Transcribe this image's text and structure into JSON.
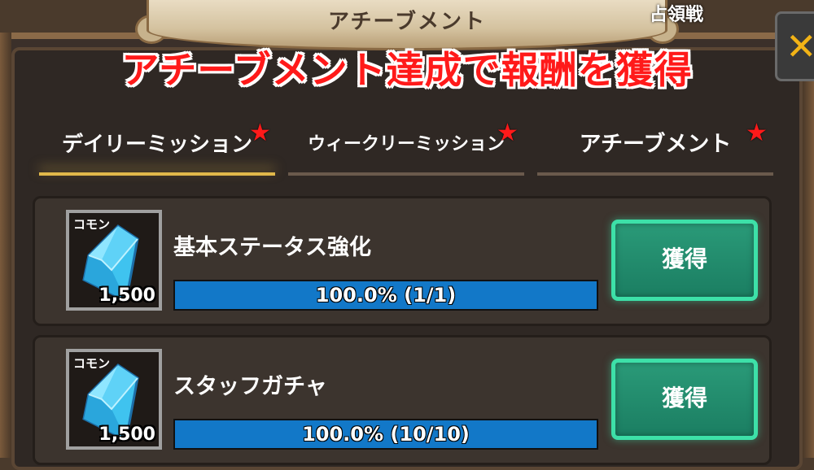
{
  "window": {
    "title": "アチーブメント",
    "top_right_label": "占領戦",
    "close_icon": "close-x-icon"
  },
  "headline": "アチーブメント達成で報酬を獲得",
  "tabs": [
    {
      "label": "デイリーミッション",
      "active": true,
      "badge": "star-icon"
    },
    {
      "label": "ウィークリーミッション",
      "active": false,
      "badge": "star-icon"
    },
    {
      "label": "アチーブメント",
      "active": false,
      "badge": "star-icon"
    }
  ],
  "missions": [
    {
      "title": "基本ステータス強化",
      "reward": {
        "rarity": "コモン",
        "icon": "blue-crystal-icon",
        "quantity": "1,500"
      },
      "progress": {
        "fraction": 1.0,
        "label": "100.0% (1/1)"
      },
      "claim_label": "獲得"
    },
    {
      "title": "スタッフガチャ",
      "reward": {
        "rarity": "コモン",
        "icon": "blue-crystal-icon",
        "quantity": "1,500"
      },
      "progress": {
        "fraction": 1.0,
        "label": "100.0% (10/10)"
      },
      "claim_label": "獲得"
    }
  ],
  "colors": {
    "headline": "#ff1a1a",
    "claim_button": "#1b7e62",
    "progress_fill": "#1278c8",
    "active_tab_underline": "#e0b84a"
  }
}
